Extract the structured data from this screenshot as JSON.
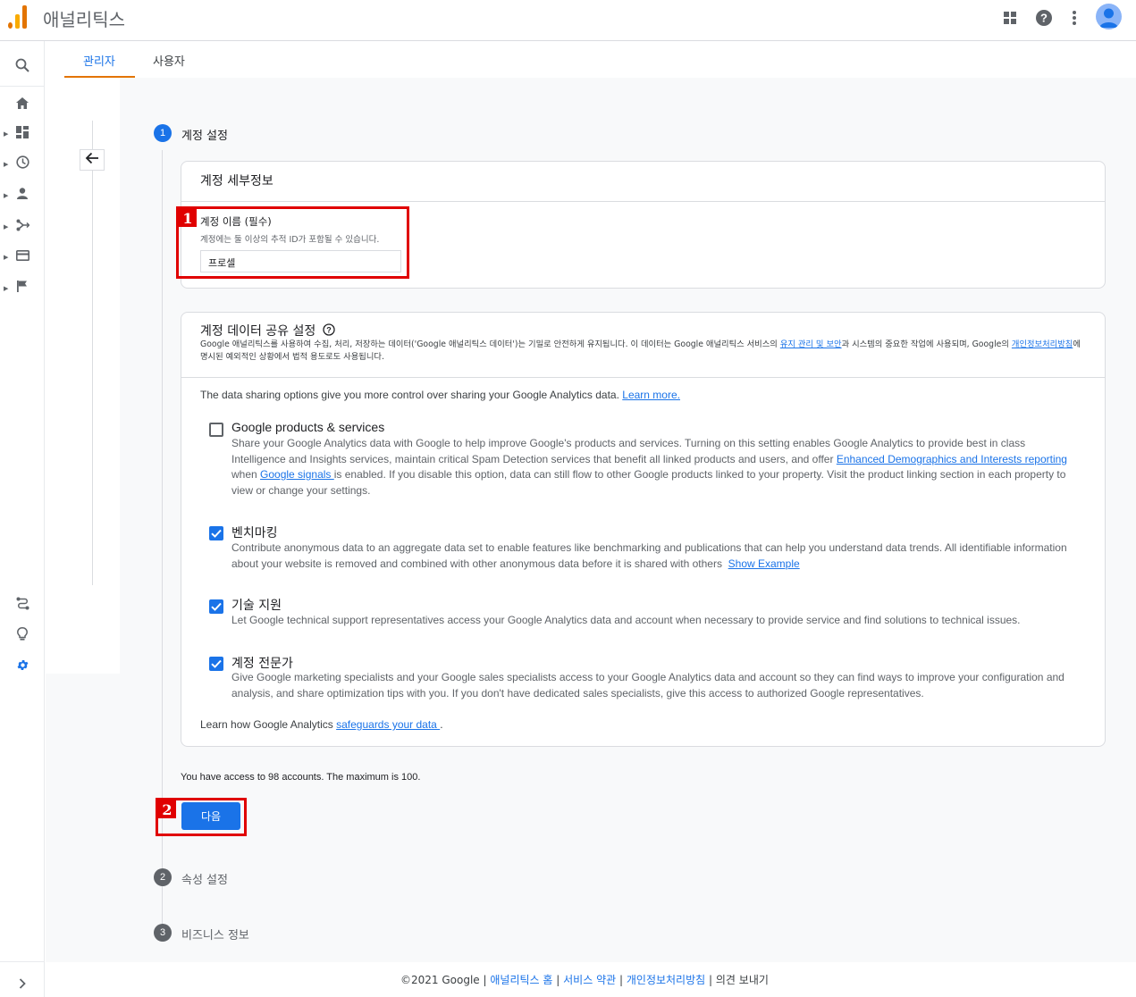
{
  "app": {
    "title": "애널리틱스"
  },
  "header": {
    "apps_icon": "apps-grid-icon",
    "help_icon": "help-icon",
    "more_icon": "more-vert-icon"
  },
  "tabs": [
    {
      "label": "관리자"
    },
    {
      "label": "사용자"
    }
  ],
  "steps": [
    {
      "number": "1",
      "label": "계정 설정"
    },
    {
      "number": "2",
      "label": "속성 설정"
    },
    {
      "number": "3",
      "label": "비즈니스 정보"
    }
  ],
  "account_details": {
    "title": "계정 세부정보",
    "name_label": "계정 이름 (필수)",
    "name_hint": "계정에는 둘 이상의 추적 ID가 포함될 수 있습니다.",
    "name_value": "프로셀"
  },
  "sharing": {
    "title": "계정 데이터 공유 설정",
    "desc_part1": "Google 애널리틱스를 사용하여 수집, 처리, 저장하는 데이터('Google 애널리틱스 데이터')는 기밀로 안전하게 유지됩니다. 이 데이터는 Google 애널리틱스 서비스의 ",
    "desc_link1": "유지 관리 및 보안",
    "desc_part2": "과 시스템의 중요한 작업에 사용되며, Google의 ",
    "desc_link2": "개인정보처리방침",
    "desc_part3": "에 명시된 예외적인 상황에서 법적 용도로도 사용됩니다.",
    "intro": "The data sharing options give you more control over sharing your Google Analytics data.",
    "intro_link": "Learn more.",
    "options": [
      {
        "title": "Google products & services",
        "checked": false,
        "desc_a": "Share your Google Analytics data with Google to help improve Google's products and services. Turning on this setting enables Google Analytics to provide best in class Intelligence and Insights services, maintain critical Spam Detection services that benefit all linked products and users, and offer ",
        "link_a": "Enhanced Demographics and Interests reporting ",
        "desc_b": "when ",
        "link_b": "Google signals ",
        "desc_c": "is enabled. If you disable this option, data can still flow to other Google products linked to your property. Visit the product linking section in each property to view or change your settings."
      },
      {
        "title": "벤치마킹",
        "checked": true,
        "desc_a": "Contribute anonymous data to an aggregate data set to enable features like benchmarking and publications that can help you understand data trends. All identifiable information about your website is removed and combined with other anonymous data before it is shared with others",
        "link_a": "Show Example"
      },
      {
        "title": "기술 지원",
        "checked": true,
        "desc_a": "Let Google technical support representatives access your Google Analytics data and account when necessary to provide service and find solutions to technical issues."
      },
      {
        "title": "계정 전문가",
        "checked": true,
        "desc_a": "Give Google marketing specialists and your Google sales specialists access to your Google Analytics data and account so they can find ways to improve your configuration and analysis, and share optimization tips with you. If you don't have dedicated sales specialists, give this access to authorized Google representatives."
      }
    ],
    "safeguards_text": "Learn how Google Analytics",
    "safeguards_link": "safeguards your data ",
    "safeguards_end": "."
  },
  "access_note": "You have access to 98 accounts. The maximum is 100.",
  "next_button": "다음",
  "annotations": {
    "tag1": "1",
    "tag2": "2"
  },
  "footer": {
    "copyright": "©2021 Google",
    "link_home": "애널리틱스 홈",
    "link_terms": "서비스 약관",
    "link_privacy": "개인정보처리방침",
    "feedback": "의견 보내기",
    "sep": "|"
  },
  "colors": {
    "accent": "#1a73e8",
    "tab_underline": "#e37400",
    "annotation": "#e00000"
  }
}
